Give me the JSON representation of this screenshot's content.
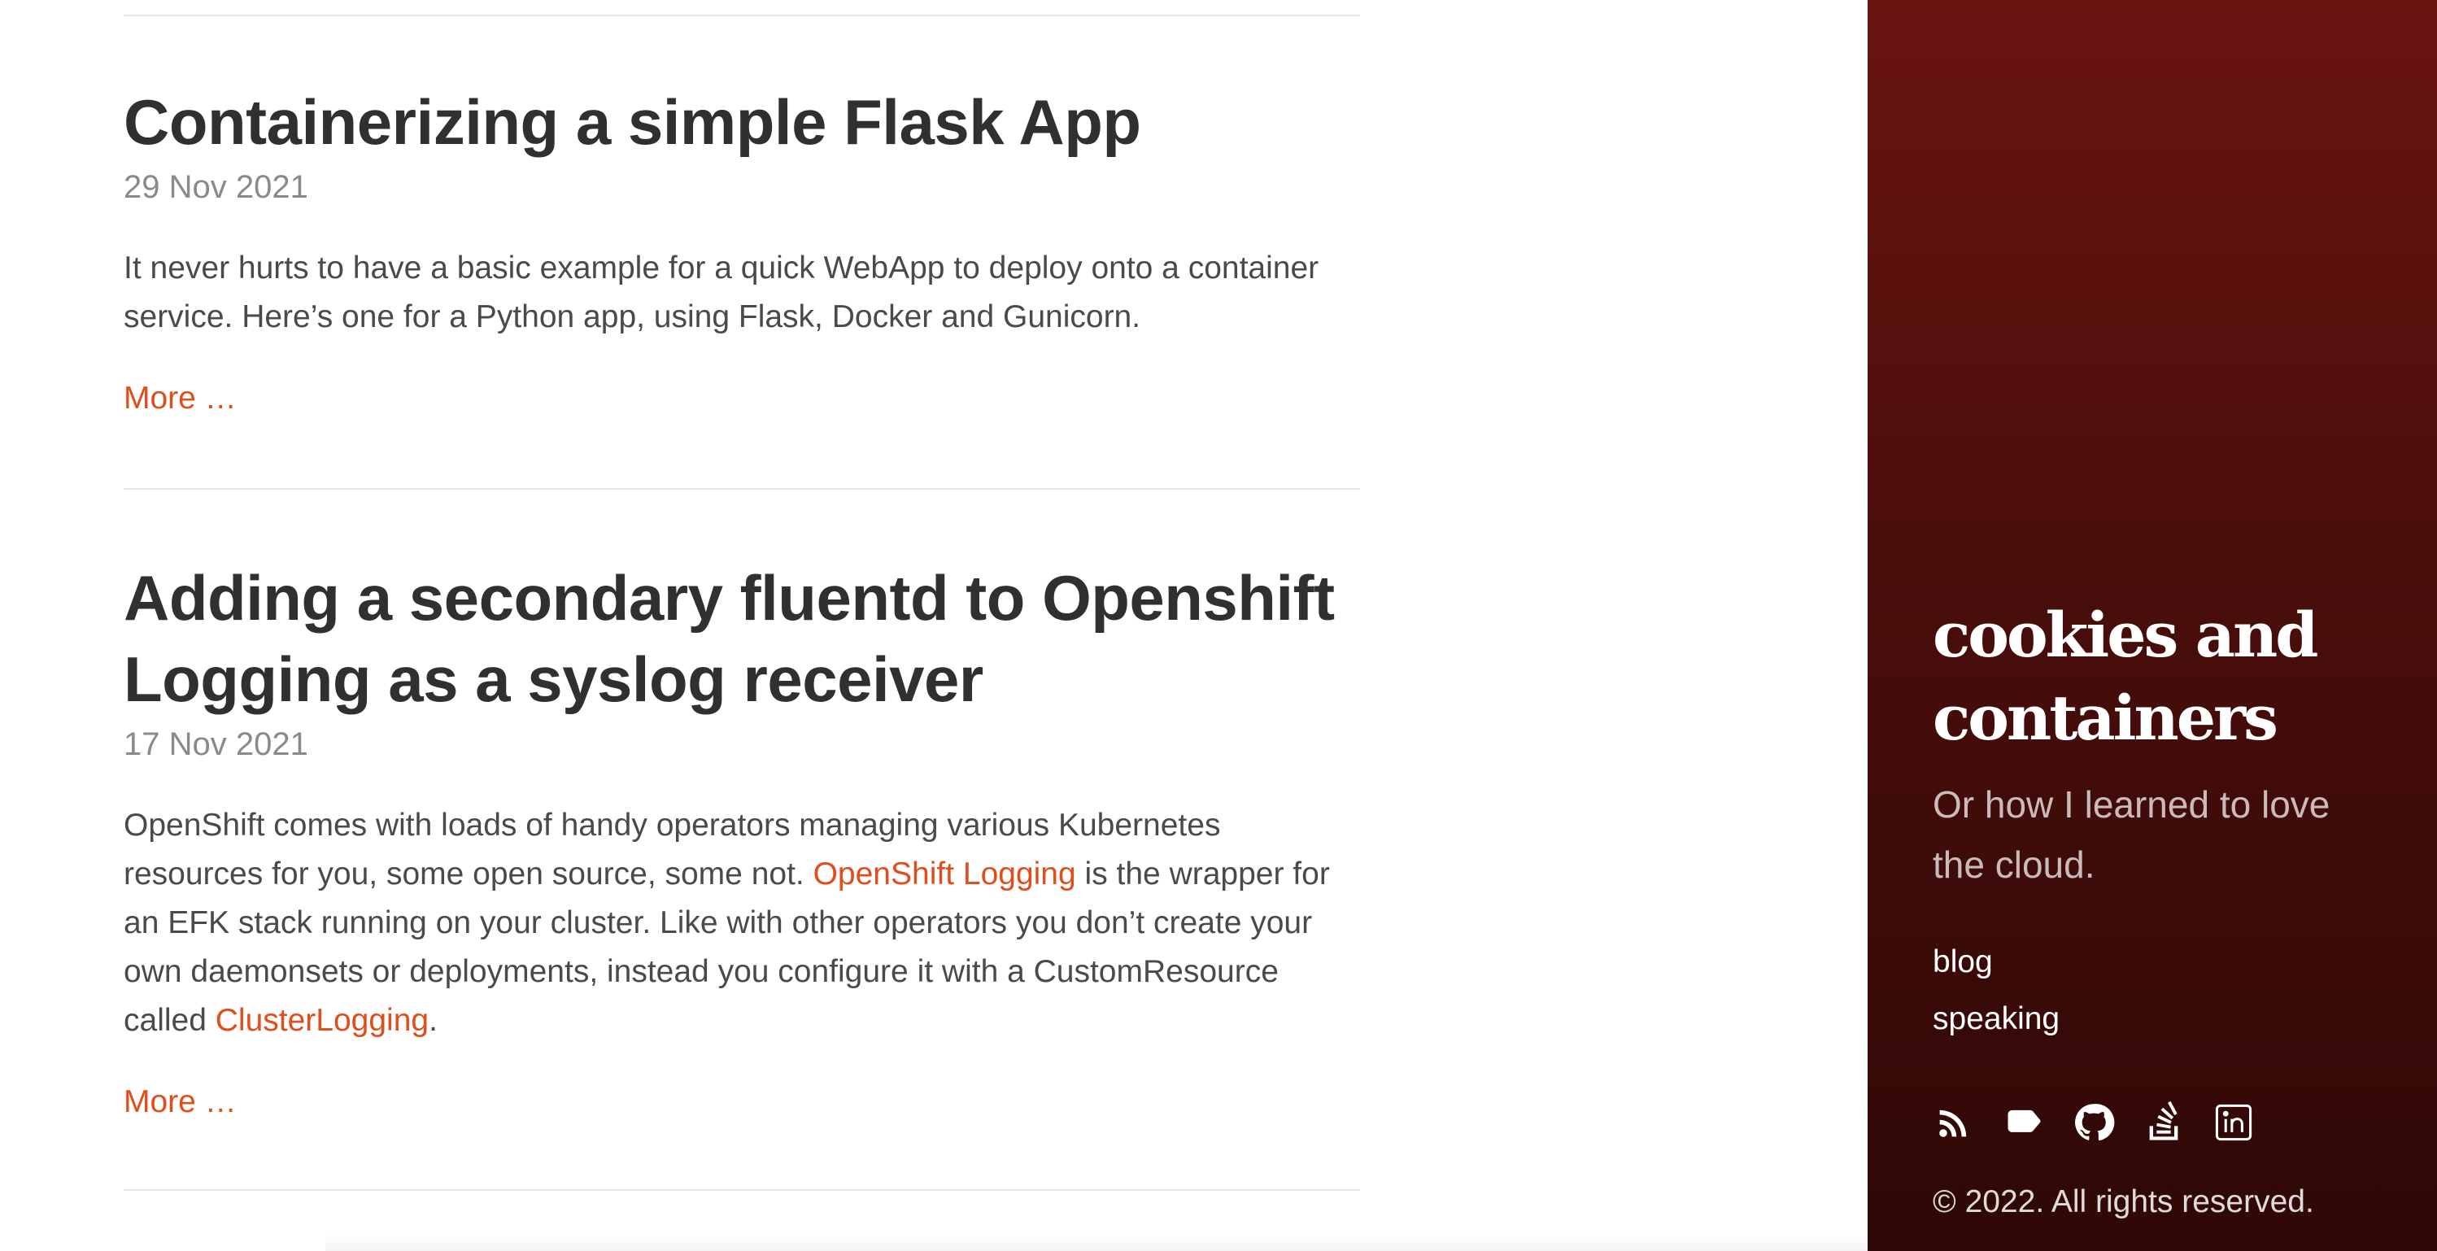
{
  "posts": [
    {
      "title": "Containerizing a simple Flask App",
      "date": "29 Nov 2021",
      "excerpt": "It never hurts to have a basic example for a quick WebApp to deploy onto a container service. Here’s one for a Python app, using Flask, Docker and Gunicorn.",
      "more_label": "More …"
    },
    {
      "title": "Adding a secondary fluentd to Openshift Logging as a syslog receiver",
      "date": "17 Nov 2021",
      "excerpt_part1": "OpenShift comes with loads of handy operators managing various Kubernetes resources for you, some open source, some not. ",
      "excerpt_link1": "OpenShift Logging",
      "excerpt_part2": " is the wrapper for an EFK stack running on your cluster. Like with other operators you don’t create your own daemonsets or deployments, instead you configure it with a CustomResource called ",
      "excerpt_link2": "ClusterLogging",
      "excerpt_part3": ".",
      "more_label": "More …"
    }
  ],
  "sidebar": {
    "title": "cookies and containers",
    "tagline": "Or how I learned to love the cloud.",
    "nav": [
      {
        "label": "blog"
      },
      {
        "label": "speaking"
      }
    ],
    "social_icons": [
      "rss-icon",
      "tag-icon",
      "github-icon",
      "stackoverflow-icon",
      "linkedin-icon"
    ],
    "copyright": "© 2022. All rights reserved."
  },
  "colors": {
    "accent": "#e04e1b",
    "sidebar_top": "#6a1410",
    "sidebar_bottom": "#2e0806"
  }
}
